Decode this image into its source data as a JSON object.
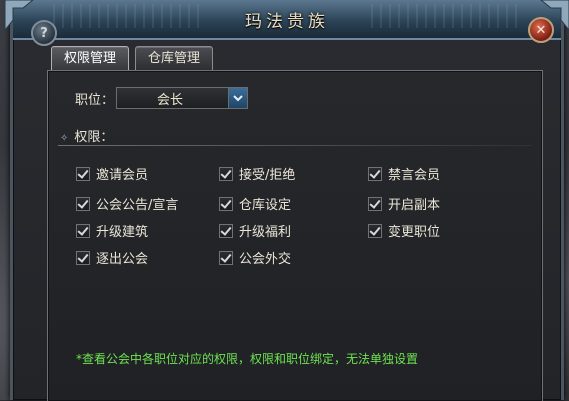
{
  "window": {
    "title": "玛法贵族",
    "help_glyph": "?",
    "close_glyph": "✕"
  },
  "tabs": [
    {
      "label": "权限管理",
      "active": true
    },
    {
      "label": "仓库管理",
      "active": false
    }
  ],
  "position": {
    "label": "职位：",
    "value": "会长"
  },
  "permissions": {
    "header": "权限：",
    "items": [
      {
        "label": "邀请会员",
        "checked": true
      },
      {
        "label": "接受/拒绝",
        "checked": true
      },
      {
        "label": "禁言会员",
        "checked": true
      },
      {
        "label": "公会公告/宣言",
        "checked": true
      },
      {
        "label": "仓库设定",
        "checked": true
      },
      {
        "label": "开启副本",
        "checked": true
      },
      {
        "label": "升级建筑",
        "checked": true
      },
      {
        "label": "升级福利",
        "checked": true
      },
      {
        "label": "变更职位",
        "checked": true
      },
      {
        "label": "逐出公会",
        "checked": true
      },
      {
        "label": "公会外交",
        "checked": true
      }
    ]
  },
  "note": "*查看公会中各职位对应的权限，权限和职位绑定，无法单独设置",
  "colors": {
    "note": "#6ee352",
    "title": "#e7ddc2"
  }
}
